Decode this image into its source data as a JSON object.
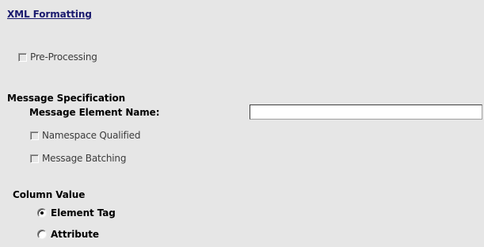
{
  "section": {
    "title": "XML Formatting"
  },
  "pre_processing": {
    "label": "Pre-Processing",
    "checked": false
  },
  "message_specification": {
    "heading": "Message Specification",
    "element_name_label": "Message Element Name:",
    "element_name_value": "",
    "namespace_qualified": {
      "label": "Namespace Qualified",
      "checked": false
    },
    "message_batching": {
      "label": "Message Batching",
      "checked": false
    }
  },
  "column_value": {
    "heading": "Column Value",
    "options": [
      {
        "label": "Element Tag",
        "selected": true
      },
      {
        "label": "Attribute",
        "selected": false
      }
    ]
  }
}
